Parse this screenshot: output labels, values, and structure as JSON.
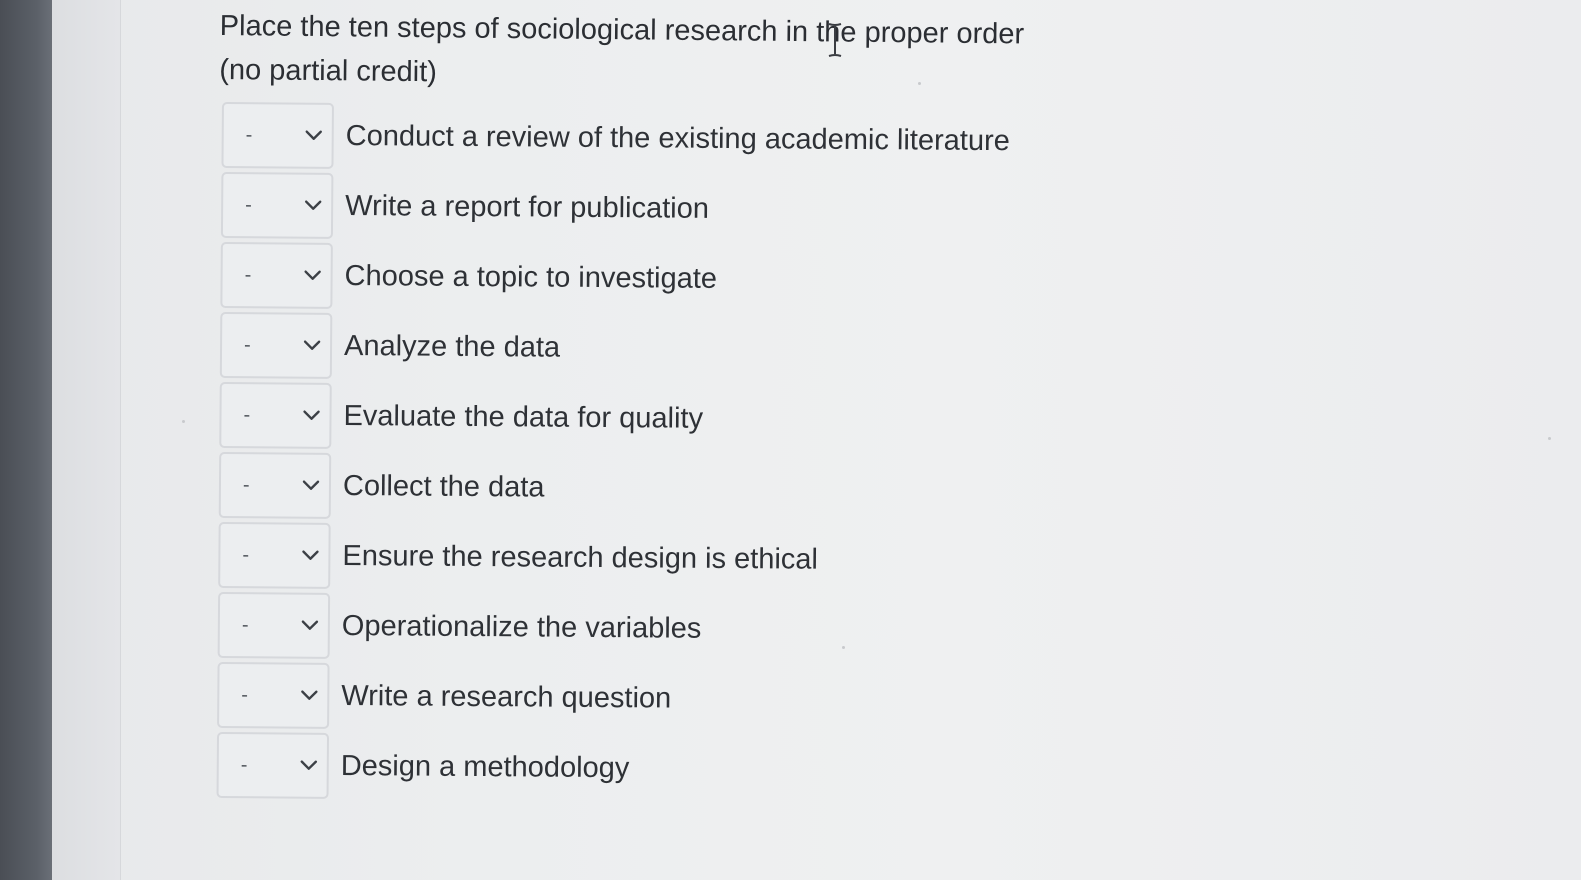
{
  "question": {
    "title_line1": "Place the ten steps of sociological research in the proper order",
    "title_line2": "(no partial credit)"
  },
  "select_default": "-",
  "items": [
    {
      "label": "Conduct a review of the existing academic literature",
      "selected": "-"
    },
    {
      "label": "Write a report for publication",
      "selected": "-"
    },
    {
      "label": "Choose a topic to investigate",
      "selected": "-"
    },
    {
      "label": "Analyze the data",
      "selected": "-"
    },
    {
      "label": "Evaluate the data for quality",
      "selected": "-"
    },
    {
      "label": "Collect the data",
      "selected": "-"
    },
    {
      "label": "Ensure the research design is ethical",
      "selected": "-"
    },
    {
      "label": "Operationalize the variables",
      "selected": "-"
    },
    {
      "label": "Write a research question",
      "selected": "-"
    },
    {
      "label": "Design a methodology",
      "selected": "-"
    }
  ],
  "icons": {
    "dropdown": "chevron-down-icon",
    "cursor": "text-cursor-icon"
  },
  "colors": {
    "text": "#2e3136",
    "select_border": "#d6d8dc",
    "bezel": "#5b6068"
  }
}
